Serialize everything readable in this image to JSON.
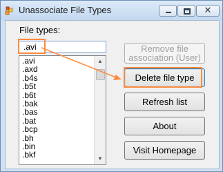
{
  "window": {
    "title": "Unassociate File Types"
  },
  "caption": {
    "minimize": "–",
    "maximize": "□",
    "close": "✕"
  },
  "form": {
    "file_types_label": "File types:",
    "file_type_value": ".avi",
    "list_items": [
      ".avi",
      ".axd",
      ".b4s",
      ".b5t",
      ".b6t",
      ".bak",
      ".bas",
      ".bat",
      ".bcp",
      ".bh",
      ".bin",
      ".bkf"
    ]
  },
  "buttons": {
    "remove_association": "Remove file association (User)",
    "delete_file_type": "Delete file type",
    "refresh_list": "Refresh list",
    "about": "About",
    "visit_homepage": "Visit Homepage"
  },
  "colors": {
    "annotation": "#ff8a3d"
  },
  "icons": {
    "app": "app-icon",
    "minimize": "minimize-icon",
    "maximize": "maximize-icon",
    "close": "close-icon"
  }
}
